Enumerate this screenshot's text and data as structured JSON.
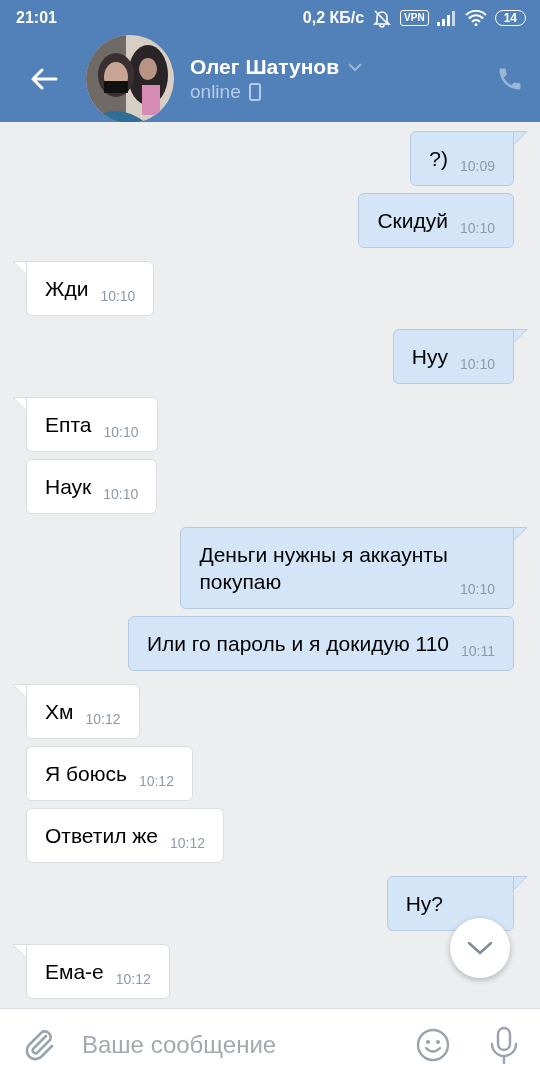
{
  "status_bar": {
    "time": "21:01",
    "speed": "0,2 КБ/с",
    "vpn": "VPN",
    "battery": "14"
  },
  "header": {
    "name": "Олег Шатунов",
    "status": "online"
  },
  "messages": [
    {
      "kind": "out",
      "tail": true,
      "text": "?)",
      "time": "10:09"
    },
    {
      "kind": "out",
      "tail": false,
      "text": "Скидуй",
      "time": "10:10"
    },
    {
      "kind": "in",
      "tail": true,
      "text": "Жди",
      "time": "10:10"
    },
    {
      "kind": "out",
      "tail": true,
      "text": "Нуу",
      "time": "10:10"
    },
    {
      "kind": "in",
      "tail": true,
      "text": "Епта",
      "time": "10:10"
    },
    {
      "kind": "in",
      "tail": false,
      "text": "Наук",
      "time": "10:10"
    },
    {
      "kind": "out",
      "tail": true,
      "text": "Деньги нужны я аккаунты\nпокупаю",
      "time": "10:10"
    },
    {
      "kind": "out",
      "tail": false,
      "text": "Или го пароль и я докидую 110",
      "time": "10:11"
    },
    {
      "kind": "in",
      "tail": true,
      "text": "Хм",
      "time": "10:12"
    },
    {
      "kind": "in",
      "tail": false,
      "text": "Я боюсь",
      "time": "10:12"
    },
    {
      "kind": "in",
      "tail": false,
      "text": "Ответил же",
      "time": "10:12"
    },
    {
      "kind": "out",
      "tail": true,
      "text": "Ну?"
    },
    {
      "kind": "in",
      "tail": true,
      "text": "Ема-е",
      "time": "10:12"
    }
  ],
  "composer": {
    "placeholder": "Ваше сообщение"
  }
}
